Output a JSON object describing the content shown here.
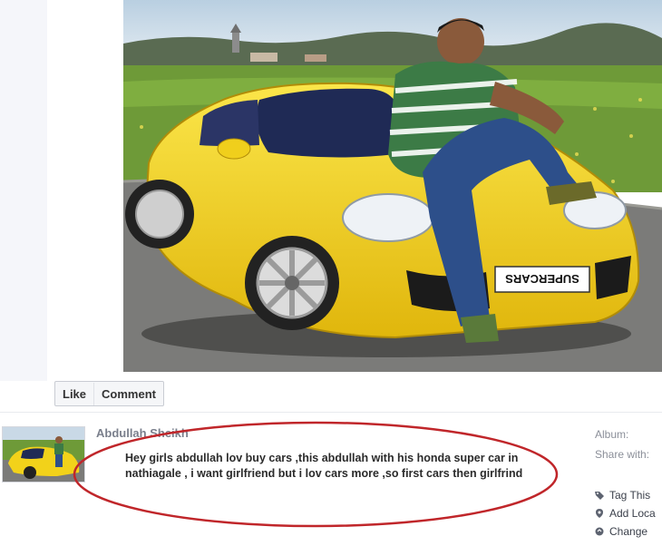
{
  "actions": {
    "like": "Like",
    "comment": "Comment"
  },
  "post": {
    "author": "Abdullah Sheikh",
    "text": "Hey girls abdullah lov buy cars ,this abdullah with his honda super car in nathiagale , i want girlfriend but i lov cars more ,so first cars then girlfrind"
  },
  "meta": {
    "album": "Album:",
    "share": "Share with:"
  },
  "side_actions": [
    {
      "label": "Tag This",
      "icon": "tag-icon"
    },
    {
      "label": "Add Loca",
      "icon": "location-pin-icon"
    },
    {
      "label": "Change",
      "icon": "change-icon"
    }
  ],
  "photo": {
    "plate_text": "SUPERCARS"
  },
  "colors": {
    "car_yellow": "#f2d21a",
    "annotation_red": "#c0262a",
    "sky": "#c9d9e6",
    "grass": "#5f8a2e"
  }
}
